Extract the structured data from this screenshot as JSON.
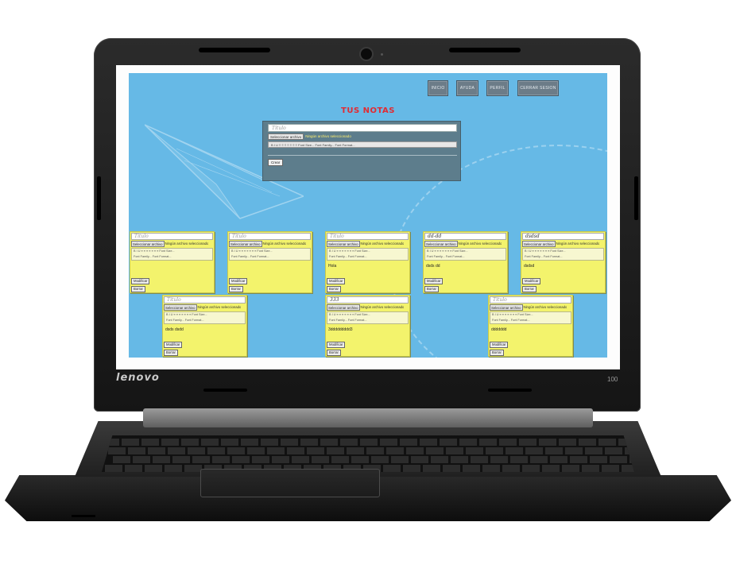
{
  "laptop": {
    "brand": "lenovo",
    "model": "100"
  },
  "nav": {
    "items": [
      {
        "label": "INICIO"
      },
      {
        "label": "AYUDA"
      },
      {
        "label": "PERFIL"
      },
      {
        "label": "CERRAR SESION"
      }
    ]
  },
  "page_title": "TUS NOTAS",
  "editor": {
    "title_placeholder": "Título",
    "file_button": "Seleccionar archivo",
    "file_status": "Ningún archivo seleccionado",
    "toolbar": "B I U ≡ ≡ ≡ ≡ ≡ ≡ ≡   Font Size...   Font Family...   Font Format...",
    "save_label": "Crear"
  },
  "notes": [
    {
      "title": "Título",
      "file_button": "Seleccionar archivo",
      "file_status": "Ningún archivo seleccionado",
      "toolbar_1": "B I U ≡ ≡ ≡ ≡ ≡ ≡ ≡   Font Size...",
      "toolbar_2": "Font Family...   Font Format...",
      "body": "",
      "modify": "Modificar",
      "delete": "Borrar"
    },
    {
      "title": "Título",
      "file_button": "Seleccionar archivo",
      "file_status": "Ningún archivo seleccionado",
      "toolbar_1": "B I U ≡ ≡ ≡ ≡ ≡ ≡ ≡   Font Size...",
      "toolbar_2": "Font Family...   Font Format...",
      "body": "",
      "modify": "Modificar",
      "delete": "Borrar"
    },
    {
      "title": "Título",
      "file_button": "Seleccionar archivo",
      "file_status": "Ningún archivo seleccionado",
      "toolbar_1": "B I U ≡ ≡ ≡ ≡ ≡ ≡ ≡   Font Size...",
      "toolbar_2": "Font Family...   Font Format...",
      "body": "Hola",
      "modify": "Modificar",
      "delete": "Borrar"
    },
    {
      "title": "dd-dd",
      "file_button": "Seleccionar archivo",
      "file_status": "Ningún archivo seleccionado",
      "toolbar_1": "B I U ≡ ≡ ≡ ≡ ≡ ≡ ≡   Font Size...",
      "toolbar_2": "Font Family...   Font Format...",
      "body": "dsds dd",
      "modify": "Modificar",
      "delete": "Borrar"
    },
    {
      "title": "dsdsd",
      "file_button": "Seleccionar archivo",
      "file_status": "Ningún archivo seleccionado",
      "toolbar_1": "B I U ≡ ≡ ≡ ≡ ≡ ≡ ≡   Font Size...",
      "toolbar_2": "Font Family...   Font Format...",
      "body": "dsdsd",
      "modify": "Modificar",
      "delete": "Borrar"
    },
    {
      "title": "Título",
      "file_button": "Seleccionar archivo",
      "file_status": "Ningún archivo seleccionado",
      "toolbar_1": "B I U ≡ ≡ ≡ ≡ ≡ ≡ ≡   Font Size...",
      "toolbar_2": "Font Family...   Font Format...",
      "body": "dsds dsdd",
      "modify": "Modificar",
      "delete": "Borrar"
    },
    {
      "title": "333",
      "file_button": "Seleccionar archivo",
      "file_status": "Ningún archivo seleccionado",
      "toolbar_1": "B I U ≡ ≡ ≡ ≡ ≡ ≡ ≡   Font Size...",
      "toolbar_2": "Font Family...   Font Format...",
      "body": "3ddddddddd3",
      "modify": "Modificar",
      "delete": "Borrar"
    },
    {
      "title": "Título",
      "file_button": "Seleccionar archivo",
      "file_status": "Ningún archivo seleccionado",
      "toolbar_1": "B I U ≡ ≡ ≡ ≡ ≡ ≡ ≡   Font Size...",
      "toolbar_2": "Font Family...   Font Format...",
      "body": "ddddddd",
      "modify": "Modificar",
      "delete": "Borrar"
    }
  ],
  "colors": {
    "page_background": "#66b9e6",
    "title_red": "#e12b33",
    "note_yellow": "#f3f36c",
    "editor_panel": "#5d7d8c",
    "nav_button": "#6c7c88"
  }
}
